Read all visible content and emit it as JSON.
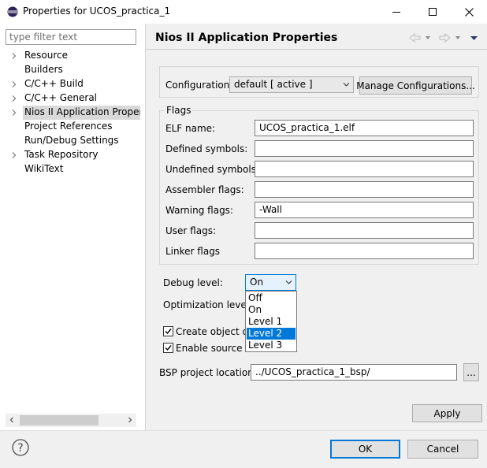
{
  "window": {
    "title": "Properties for UCOS_practica_1",
    "minimize_glyph": "—",
    "maximize_glyph": "☐",
    "close_glyph": "✕"
  },
  "filter": {
    "placeholder": "type filter text",
    "value": ""
  },
  "tree": [
    {
      "label": "Resource",
      "expandable": true,
      "selected": false
    },
    {
      "label": "Builders",
      "expandable": false,
      "selected": false
    },
    {
      "label": "C/C++ Build",
      "expandable": true,
      "selected": false
    },
    {
      "label": "C/C++ General",
      "expandable": true,
      "selected": false
    },
    {
      "label": "Nios II Application Properti",
      "expandable": true,
      "selected": true
    },
    {
      "label": "Project References",
      "expandable": false,
      "selected": false
    },
    {
      "label": "Run/Debug Settings",
      "expandable": false,
      "selected": false
    },
    {
      "label": "Task Repository",
      "expandable": true,
      "selected": false
    },
    {
      "label": "WikiText",
      "expandable": false,
      "selected": false
    }
  ],
  "page": {
    "title": "Nios II Application Properties",
    "configuration_label": "Configuration:",
    "configuration_value": "default  [ active ]",
    "manage_button": "Manage Configurations...",
    "flags_group": "Flags",
    "fields": [
      {
        "label": "ELF name:",
        "value": "UCOS_practica_1.elf"
      },
      {
        "label": "Defined symbols:",
        "value": ""
      },
      {
        "label": "Undefined symbols:",
        "value": ""
      },
      {
        "label": "Assembler flags:",
        "value": ""
      },
      {
        "label": "Warning flags:",
        "value": "-Wall"
      },
      {
        "label": "User flags:",
        "value": ""
      },
      {
        "label": "Linker flags",
        "value": ""
      }
    ],
    "debug_level_label": "Debug level:",
    "debug_level_value": "On",
    "debug_level_options": [
      "Off",
      "On",
      "Level 1",
      "Level 2",
      "Level 3"
    ],
    "debug_level_highlighted": "Level 2",
    "optimization_label": "Optimization level:",
    "create_object_label": "Create object du",
    "create_object_checked": true,
    "enable_source_label": "Enable source m",
    "enable_source_checked": true,
    "bsp_label": "BSP project location:",
    "bsp_value": "../UCOS_practica_1_bsp/",
    "browse_button": "...",
    "apply_button": "Apply"
  },
  "footer": {
    "help_glyph": "?",
    "ok_button": "OK",
    "cancel_button": "Cancel"
  },
  "colors": {
    "accent": "#0078d7",
    "selection": "#d9d9d9",
    "background": "#f0f0f0"
  }
}
